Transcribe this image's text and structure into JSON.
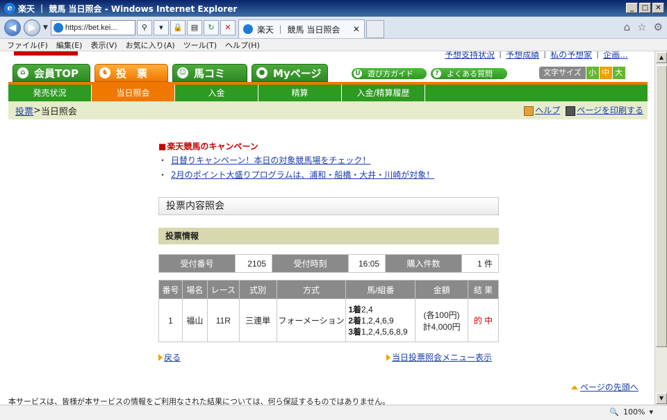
{
  "window": {
    "title": "楽天 ｜ 競馬 当日照会 - Windows Internet Explorer",
    "minimize": "_",
    "maximize": "□",
    "close": "✕"
  },
  "browser": {
    "address": "https://bet.kei...",
    "tab_title": "楽天 ｜ 競馬 当日照会",
    "tab_close": "✕",
    "zoom": "100%",
    "menu": [
      "ファイル(F)",
      "編集(E)",
      "表示(V)",
      "お気に入り(A)",
      "ツール(T)",
      "ヘルプ(H)"
    ]
  },
  "site": {
    "top_links": [
      "予想支持状況",
      "予想成績",
      "私の予想家",
      "企画..."
    ],
    "main_tabs": [
      "会員TOP",
      "投　票",
      "馬コミ",
      "Myページ"
    ],
    "guides": [
      "遊び方ガイド",
      "よくある質問"
    ],
    "font_size_label": "文字サイズ",
    "font_sizes": [
      "小",
      "中",
      "大"
    ],
    "subnav": [
      "発売状況",
      "当日照会",
      "入金",
      "精算",
      "入金/精算履歴"
    ],
    "breadcrumb": {
      "link": "投票",
      "sep": " > ",
      "current": "当日照会"
    },
    "help_link": "ヘルプ",
    "print_link": "ページを印刷する"
  },
  "campaign": {
    "title": "楽天競馬のキャンペーン",
    "links": [
      "日替りキャンペーン！本日の対象競馬場をチェック！",
      "2月のポイント大盛りプログラムは、浦和・船橋・大井・川崎が対象！"
    ]
  },
  "page_title": "投票内容照会",
  "section": "投票情報",
  "info": {
    "receipt_no_label": "受付番号",
    "receipt_no": "2105",
    "time_label": "受付時刻",
    "time": "16:05",
    "count_label": "購入件数",
    "count": "1 件"
  },
  "detail": {
    "headers": [
      "番号",
      "場名",
      "レース",
      "式別",
      "方式",
      "馬/組番",
      "金額",
      "結 果"
    ],
    "row": {
      "no": "1",
      "venue": "福山",
      "race": "11R",
      "type": "三連単",
      "method": "フォーメーション",
      "combo": [
        {
          "label": "1着",
          "value": "2,4"
        },
        {
          "label": "2着",
          "value": "1,2,4,6,9"
        },
        {
          "label": "3着",
          "value": "1,2,4,5,6,8,9"
        }
      ],
      "amount_each": "(各100円)",
      "amount_total": "計4,000円",
      "result": "的 中"
    }
  },
  "links": {
    "back": "戻る",
    "menu": "当日投票照会メニュー表示",
    "pagetop": "ページの先頭へ"
  },
  "disclaimer": "本サービスは、皆様が本サービスの情報をご利用なされた結果については、何ら保証するものではありません。"
}
